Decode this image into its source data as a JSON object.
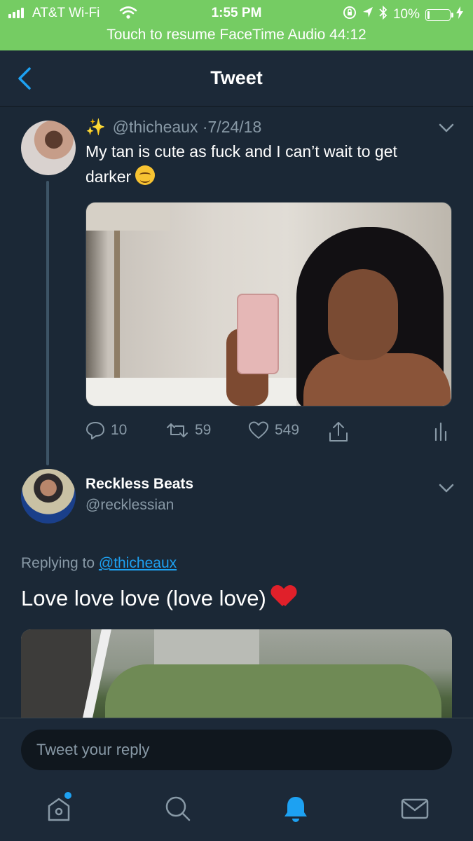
{
  "status_bar": {
    "carrier": "AT&T Wi-Fi",
    "time": "1:55 PM",
    "battery_percent": "10%",
    "battery_level": 0.1,
    "banner": "Touch to resume FaceTime Audio 44:12",
    "banner_color": "#75cc63"
  },
  "nav": {
    "title": "Tweet",
    "back_icon": "chevron-left-icon"
  },
  "quoted_tweet": {
    "prefix_emoji": "✨",
    "handle": "@thicheaux",
    "separator": "·",
    "date": "7/24/18",
    "text": "My tan is cute as fuck and I can’t wait to get darker",
    "text_emoji": "relieved-face",
    "actions": {
      "replies": "10",
      "retweets": "59",
      "likes": "549"
    }
  },
  "reply_tweet": {
    "name": "Reckless Beats",
    "handle": "@recklessian",
    "replying_prefix": "Replying to",
    "replying_to": "@thicheaux",
    "text": "Love love love (love love)",
    "text_emoji": "red-heart"
  },
  "composer": {
    "placeholder": "Tweet your reply"
  },
  "tabbar": {
    "items": [
      "home-icon",
      "search-icon",
      "notifications-icon",
      "messages-icon"
    ],
    "active": "notifications-icon",
    "accent": "#1da1f2"
  }
}
